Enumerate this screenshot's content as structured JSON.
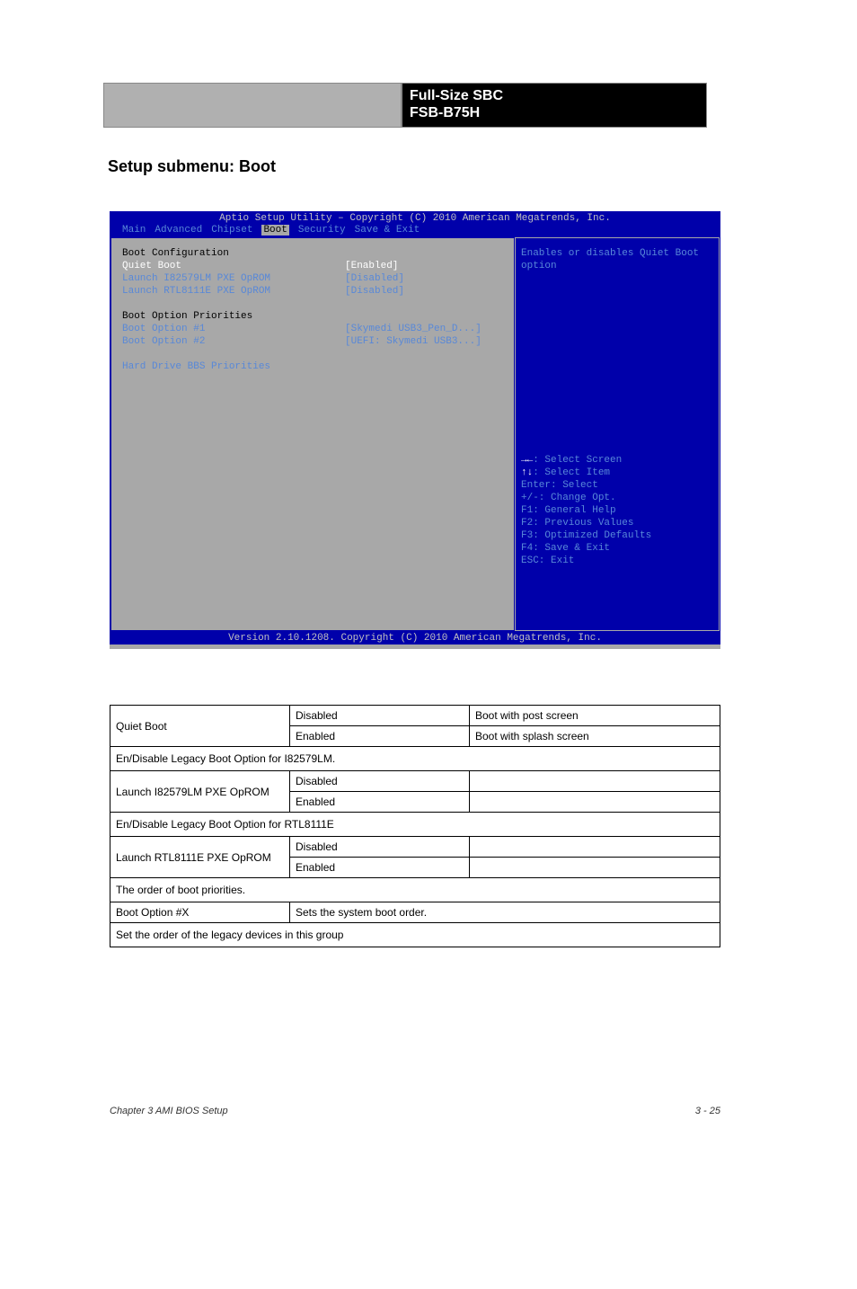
{
  "header": {
    "right1": "Full-Size SBC",
    "right2": "FSB-B75H"
  },
  "section_title": "Setup submenu: Boot",
  "subsection_title": "",
  "bios": {
    "title": "Aptio Setup Utility – Copyright (C) 2010 American Megatrends, Inc.",
    "tabs": [
      "Main",
      "Advanced",
      "Chipset",
      "Boot",
      "Security",
      "Save & Exit"
    ],
    "active_tab": "Boot",
    "left": {
      "boot_config_heading": "Boot Configuration",
      "quiet_boot_label": "Quiet Boot",
      "quiet_boot_value": "[Enabled]",
      "pxe1_label": "Launch I82579LM PXE OpROM",
      "pxe1_value": "[Disabled]",
      "pxe2_label": "Launch RTL8111E PXE OpROM",
      "pxe2_value": "[Disabled]",
      "priorities_heading": "Boot Option Priorities",
      "opt1_label": "Boot Option #1",
      "opt1_value": "[Skymedi USB3_Pen_D...]",
      "opt2_label": "Boot Option #2",
      "opt2_value": "[UEFI: Skymedi USB3...]",
      "hdd_bbs_label": "Hard Drive BBS Priorities"
    },
    "right": {
      "help_text": "Enables or disables Quiet Boot option",
      "keys": {
        "select_screen": "→←: Select Screen",
        "select_item": "↑↓: Select Item",
        "enter": "Enter: Select",
        "change": "+/-: Change Opt.",
        "f1": "F1: General Help",
        "f2": "F2: Previous Values",
        "f3": "F3: Optimized Defaults",
        "f4": "F4: Save & Exit",
        "esc": "ESC: Exit"
      }
    },
    "footer": "Version 2.10.1208. Copyright (C) 2010 American Megatrends, Inc."
  },
  "table": {
    "quiet_boot": {
      "label": "Quiet Boot",
      "v1": "Disabled",
      "d1": "Boot with post screen",
      "v2": "Enabled",
      "d2": "Boot with splash screen"
    },
    "pxe1": {
      "long": "En/Disable Legacy Boot Option for I82579LM.",
      "label": "Launch I82579LM PXE OpROM",
      "v1": "Disabled",
      "d1": "",
      "v2": "Enabled",
      "d2": ""
    },
    "pxe2": {
      "long": "En/Disable Legacy Boot Option for RTL8111E",
      "label": "Launch RTL8111E PXE OpROM",
      "v1": "Disabled",
      "d1": "",
      "v2": "Enabled",
      "d2": ""
    },
    "boot_opt": {
      "long": "The order of boot priorities.",
      "label": "Boot Option #X",
      "desc": "Sets the system boot order."
    },
    "bbs": {
      "long": "Set the order of the legacy devices in this group"
    }
  },
  "footer": {
    "chapter": "Chapter 3 AMI BIOS Setup",
    "page": "3 - 25"
  }
}
